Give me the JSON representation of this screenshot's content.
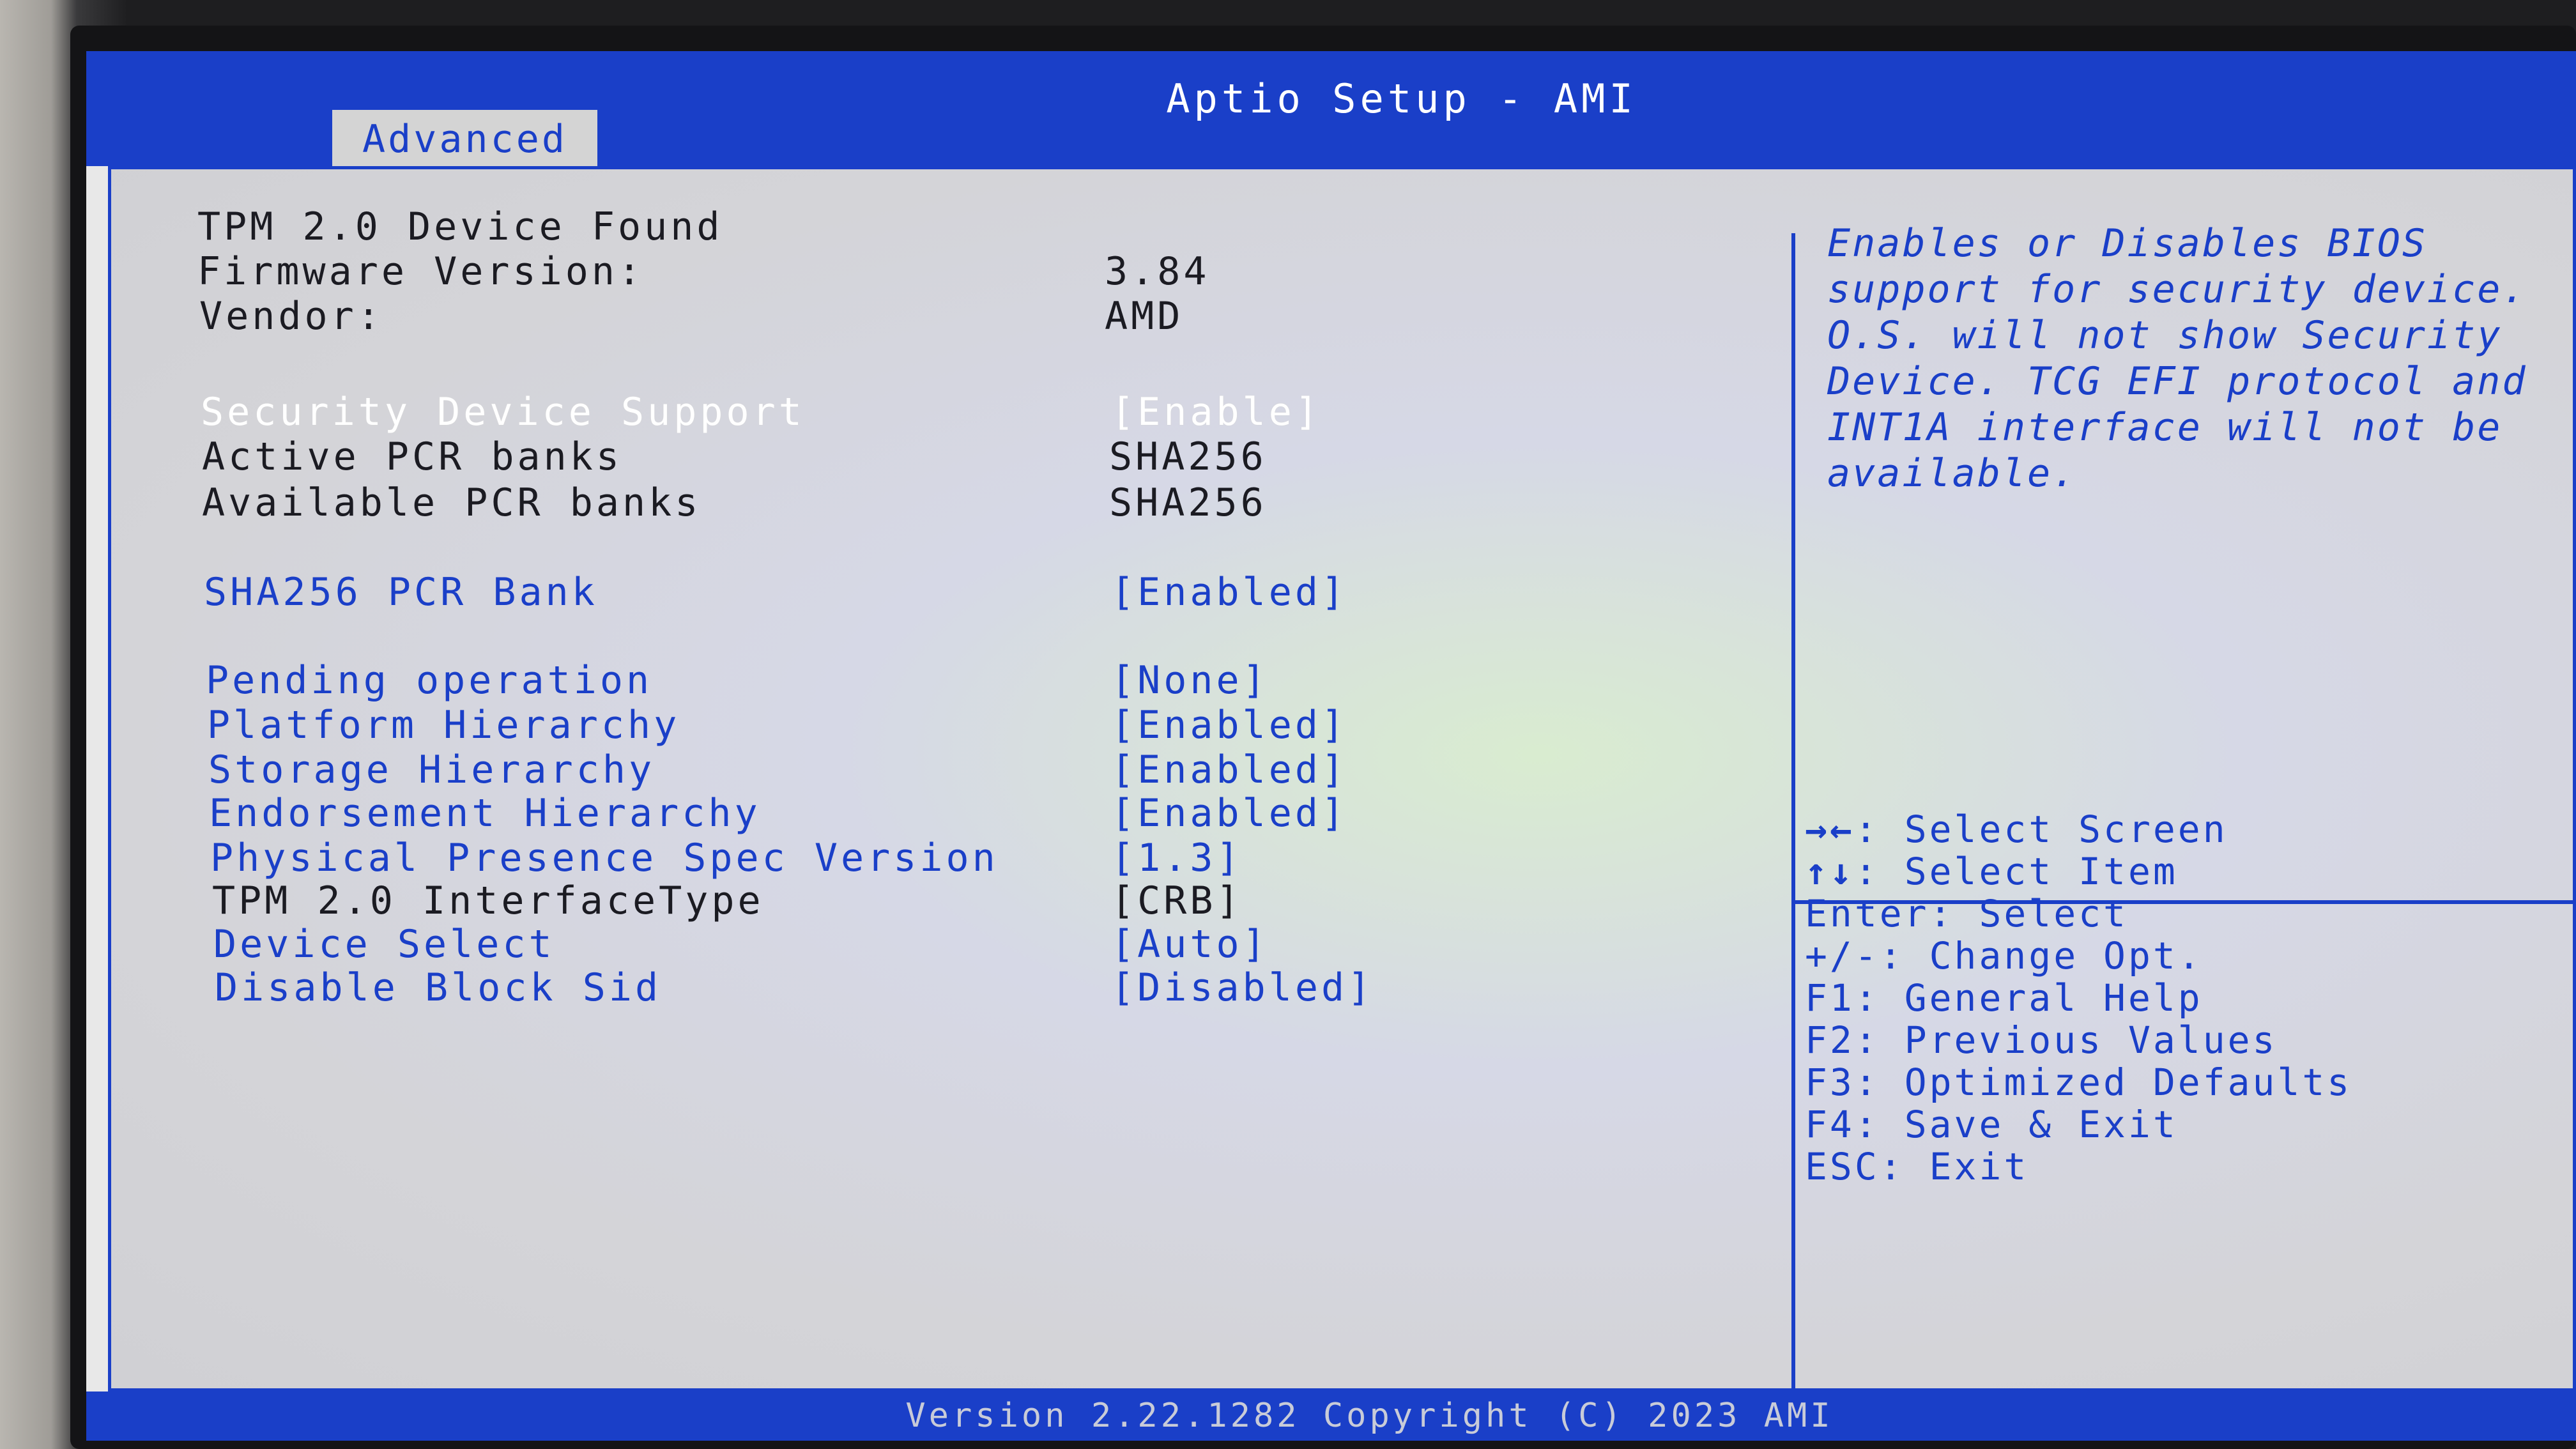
{
  "window": {
    "title": "Aptio Setup - AMI",
    "active_tab": "Advanced"
  },
  "rows": [
    {
      "label": "TPM 2.0 Device Found",
      "value": "",
      "color": "black"
    },
    {
      "label": "Firmware Version:",
      "value": "3.84",
      "color": "black"
    },
    {
      "label": "Vendor:",
      "value": "AMD",
      "color": "black"
    },
    {
      "label": "Security Device Support",
      "value": "[Enable]",
      "color": "white",
      "selected": true
    },
    {
      "label": "Active PCR banks",
      "value": "SHA256",
      "color": "black"
    },
    {
      "label": "Available PCR banks",
      "value": "SHA256",
      "color": "black"
    },
    {
      "label": "SHA256 PCR Bank",
      "value": "[Enabled]",
      "color": "blue"
    },
    {
      "label": "Pending operation",
      "value": "[None]",
      "color": "blue"
    },
    {
      "label": "Platform Hierarchy",
      "value": "[Enabled]",
      "color": "blue"
    },
    {
      "label": "Storage Hierarchy",
      "value": "[Enabled]",
      "color": "blue"
    },
    {
      "label": "Endorsement Hierarchy",
      "value": "[Enabled]",
      "color": "blue"
    },
    {
      "label": "Physical Presence Spec Version",
      "value": "[1.3]",
      "color": "blue"
    },
    {
      "label": "TPM 2.0 InterfaceType",
      "value": "[CRB]",
      "color": "black"
    },
    {
      "label": "Device Select",
      "value": "[Auto]",
      "color": "blue"
    },
    {
      "label": "Disable Block Sid",
      "value": "[Disabled]",
      "color": "blue"
    }
  ],
  "help_text": "Enables or Disables BIOS\nsupport for security device.\nO.S. will not show Security\nDevice. TCG EFI protocol and\nINT1A interface will not be\navailable.",
  "keys": [
    {
      "icon": "left-right-arrows-icon",
      "glyph": "→←",
      "key": ":",
      "desc": "Select Screen"
    },
    {
      "icon": "up-down-arrows-icon",
      "glyph": "↑↓",
      "key": ":",
      "desc": "Select Item"
    },
    {
      "key": "Enter:",
      "desc": "Select"
    },
    {
      "key": "+/-:",
      "desc": "Change Opt."
    },
    {
      "key": "F1:",
      "desc": "General Help"
    },
    {
      "key": "F2:",
      "desc": "Previous Values"
    },
    {
      "key": "F3:",
      "desc": "Optimized Defaults"
    },
    {
      "key": "F4:",
      "desc": "Save & Exit"
    },
    {
      "key": "ESC:",
      "desc": "Exit"
    }
  ],
  "footer": "Version 2.22.1282 Copyright (C) 2023 AMI",
  "colors": {
    "bar_blue": "#1a3fc8",
    "panel_gray": "#d4d4d4",
    "text_black": "#1b1b22",
    "text_white": "#ffffff"
  }
}
